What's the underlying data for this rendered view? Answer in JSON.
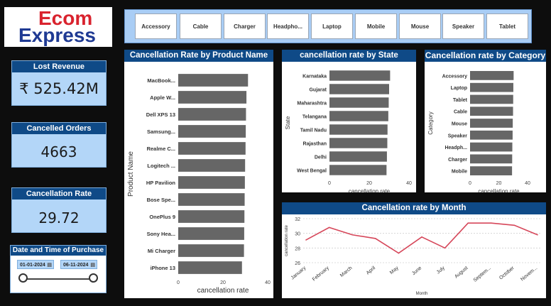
{
  "logo": {
    "line1": "Ecom",
    "line2": "Express"
  },
  "product_slicer": {
    "items": [
      "Accessory",
      "Cable",
      "Charger",
      "Headpho...",
      "Laptop",
      "Mobile",
      "Mouse",
      "Speaker",
      "Tablet"
    ]
  },
  "kpis": {
    "lost_revenue": {
      "label": "Lost Revenue",
      "value": "₹ 525.42M"
    },
    "cancelled_orders": {
      "label": "Cancelled Orders",
      "value": "4663"
    },
    "cancellation_rate": {
      "label": "Cancellation Rate",
      "value": "29.72"
    }
  },
  "date_slicer": {
    "label": "Date and Time of Purchase",
    "start": "01-01-2024",
    "end": "06-11-2024"
  },
  "chart_data": [
    {
      "id": "product",
      "type": "bar",
      "orientation": "horizontal",
      "title": "Cancellation Rate by Product Name",
      "xlabel": "cancellation rate",
      "ylabel": "Product Name",
      "xlim": [
        0,
        40
      ],
      "xticks": [
        "0",
        "20",
        "40"
      ],
      "categories": [
        "MacBook...",
        "Apple W...",
        "Dell XPS 13",
        "Samsung...",
        "Realme C...",
        "Logitech ...",
        "HP Pavilion",
        "Bose Spe...",
        "OnePlus 9",
        "Sony Hea...",
        "Mi Charger",
        "iPhone 13"
      ],
      "values": [
        31.2,
        30.5,
        30.3,
        30.2,
        30.1,
        29.9,
        29.8,
        29.7,
        29.6,
        29.5,
        29.4,
        28.5
      ],
      "bar_color": "#666666"
    },
    {
      "id": "state",
      "type": "bar",
      "orientation": "horizontal",
      "title": "cancellation rate by State",
      "xlabel": "cancellation rate",
      "ylabel": "State",
      "xlim": [
        0,
        40
      ],
      "xticks": [
        "0",
        "20",
        "40"
      ],
      "categories": [
        "Karnataka",
        "Gujarat",
        "Maharashtra",
        "Telangana",
        "Tamil Nadu",
        "Rajasthan",
        "Delhi",
        "West Bengal"
      ],
      "values": [
        30.5,
        30.0,
        29.8,
        29.6,
        29.2,
        29.1,
        28.9,
        28.7
      ],
      "bar_color": "#666666"
    },
    {
      "id": "category",
      "type": "bar",
      "orientation": "horizontal",
      "title": "Cancellation rate by Category",
      "xlabel": "cancellation rate",
      "ylabel": "Category",
      "xlim": [
        0,
        40
      ],
      "xticks": [
        "0",
        "20",
        "40"
      ],
      "categories": [
        "Accessory",
        "Laptop",
        "Tablet",
        "Cable",
        "Mouse",
        "Speaker",
        "Headph...",
        "Charger",
        "Mobile"
      ],
      "values": [
        30.3,
        30.1,
        30.0,
        29.9,
        29.7,
        29.6,
        29.4,
        29.3,
        29.2
      ],
      "bar_color": "#666666"
    },
    {
      "id": "month",
      "type": "line",
      "title": "Cancellation rate by Month",
      "xlabel": "Month",
      "ylabel": "cancellation rate",
      "ylim": [
        26,
        32
      ],
      "yticks": [
        "26",
        "28",
        "30",
        "32"
      ],
      "categories": [
        "January",
        "February",
        "March",
        "April",
        "May",
        "June",
        "July",
        "August",
        "Septem...",
        "October",
        "Novem..."
      ],
      "values": [
        29.1,
        30.8,
        29.8,
        29.3,
        27.3,
        29.5,
        28.0,
        31.4,
        31.4,
        31.1,
        29.8
      ],
      "line_color": "#d6475a",
      "grid": true
    }
  ]
}
